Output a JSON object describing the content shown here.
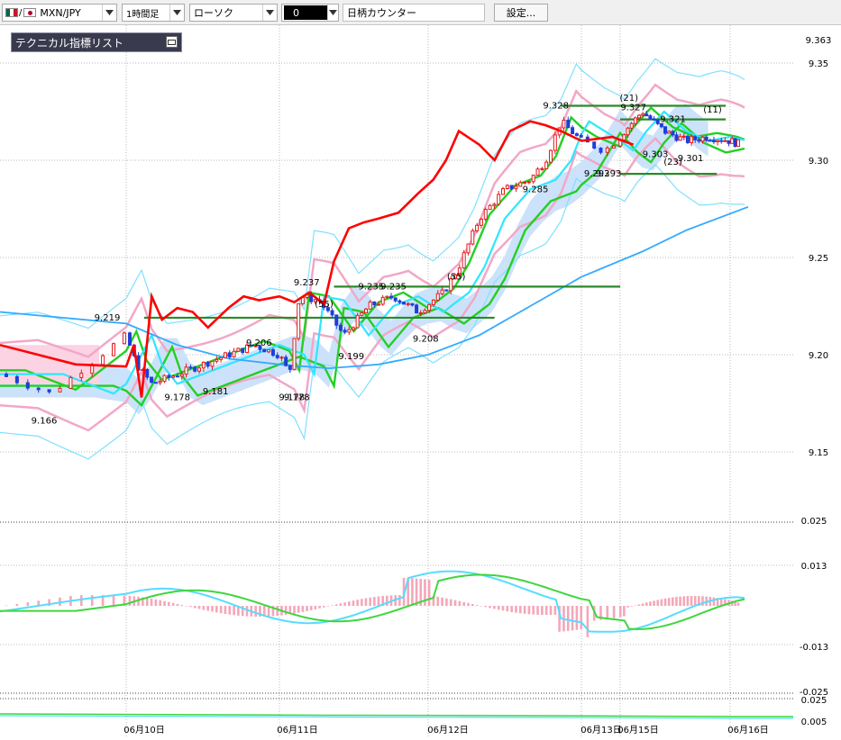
{
  "toolbar": {
    "symbol": "MXN/JPY",
    "timeframe": "1時間足",
    "chart_style": "ローソク",
    "color_value": "0",
    "counter_label": "日柄カウンター",
    "settings_label": "設定..."
  },
  "indicator_panel": {
    "title": "テクニカル指標リスト"
  },
  "colors": {
    "candle_up": "#e41a1c",
    "candle_down": "#1f3fd6",
    "bollinger_outer": "#7fe0ff",
    "bollinger_inner": "#f2a7c8",
    "ma_green": "#22d022",
    "ma_blue": "#33aaff",
    "tenkan_red": "#ff0000",
    "cloud_blue": "#cce2fa",
    "cloud_pink": "#fbd3e3",
    "hline_green": "#2a8a2a",
    "macd_hist": "#f4a7b9",
    "macd_line": "#56dcff",
    "signal_line": "#3ed63e"
  },
  "chart_data": [
    {
      "type": "candlestick",
      "y_ticks": [
        "9.363",
        "9.35",
        "9.30",
        "9.25",
        "9.20",
        "9.15"
      ],
      "x_ticks": [
        "06月10日",
        "06月11日",
        "06月12日",
        "06月13日",
        "06月15日",
        "06月16日"
      ],
      "ylim": [
        9.132,
        9.367
      ],
      "annotations": [
        {
          "text": "9.219",
          "x": 0.85,
          "y": 9.219
        },
        {
          "text": "9.166",
          "x": 0.35,
          "y": 9.166
        },
        {
          "text": "9.178",
          "x": 2.0,
          "y": 9.178
        },
        {
          "text": "9.181",
          "x": 2.75,
          "y": 9.181
        },
        {
          "text": "9.206",
          "x": 3.6,
          "y": 9.206
        },
        {
          "text": "9.178",
          "x": 4.25,
          "y": 9.178
        },
        {
          "text": "9.178",
          "x": 4.35,
          "y": 9.178
        },
        {
          "text": "9.237",
          "x": 4.55,
          "y": 9.237
        },
        {
          "text": "9.199",
          "x": 5.45,
          "y": 9.199
        },
        {
          "text": "9.235",
          "x": 5.85,
          "y": 9.235
        },
        {
          "text": "9.235",
          "x": 6.3,
          "y": 9.235
        },
        {
          "text": "9.208",
          "x": 6.95,
          "y": 9.208
        },
        {
          "text": "9.285",
          "x": 9.1,
          "y": 9.285
        },
        {
          "text": "9.328",
          "x": 9.5,
          "y": 9.328
        },
        {
          "text": "9.293",
          "x": 10.2,
          "y": 9.293
        },
        {
          "text": "9.293",
          "x": 10.35,
          "y": 9.293
        },
        {
          "text": "9.327",
          "x": 10.8,
          "y": 9.327
        },
        {
          "text": "9.303",
          "x": 11.3,
          "y": 9.303
        },
        {
          "text": "9.321",
          "x": 11.7,
          "y": 9.321
        },
        {
          "text": "9.301",
          "x": 12.1,
          "y": 9.301
        },
        {
          "text": "(21)",
          "x": 10.7,
          "y": 9.332
        },
        {
          "text": "(11)",
          "x": 12.6,
          "y": 9.326
        },
        {
          "text": "(23)",
          "x": 11.7,
          "y": 9.299
        },
        {
          "text": "(55)",
          "x": 7.55,
          "y": 9.24
        },
        {
          "text": "(55)",
          "x": 4.9,
          "y": 9.226
        }
      ],
      "horizontal_lines": [
        {
          "from": 1.35,
          "to": 8.3,
          "y": 9.219
        },
        {
          "from": 5.1,
          "to": 10.5,
          "y": 9.235
        },
        {
          "from": 9.6,
          "to": 12.9,
          "y": 9.328
        },
        {
          "from": 10.5,
          "to": 12.9,
          "y": 9.321
        },
        {
          "from": 10.5,
          "to": 12.7,
          "y": 9.293
        }
      ]
    },
    {
      "type": "macd",
      "y_ticks": [
        "0.025",
        "0.013",
        "-0.013",
        "-0.025"
      ],
      "ylim": [
        -0.0285,
        0.0285
      ]
    },
    {
      "type": "line",
      "y_ticks": [
        "0.025",
        "0.005"
      ]
    }
  ]
}
